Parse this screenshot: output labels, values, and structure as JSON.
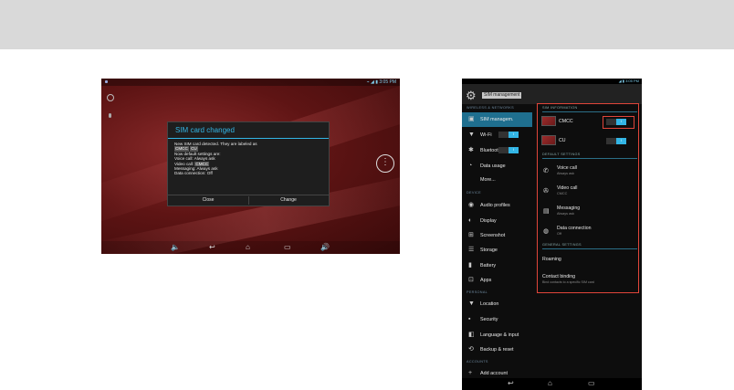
{
  "tablet": {
    "status_right": "⌁ ◢ ▮ 3:05 PM",
    "dialog": {
      "title": "SIM card changed",
      "line1": "New SIM card detected. They are labeled as",
      "chip1": "CMCC",
      "chip2": "CU",
      "line2": "Now default settings are:",
      "voice_label": "Voice call:",
      "voice_value": "Always ask",
      "video_label": "Video call:",
      "video_value": "CMCC",
      "msg_label": "Messaging:",
      "msg_value": "Always ask",
      "data_label": "Data connection:",
      "data_value": "Off",
      "close_button": "Close",
      "change_button": "Change"
    }
  },
  "phone": {
    "status_right": "◢ ▮ 3:05 PM",
    "title": "SIM management",
    "left": {
      "sec_wireless": "WIRELESS & NETWORKS",
      "items": [
        {
          "label": "SIM managem."
        },
        {
          "label": "Wi-Fi"
        },
        {
          "label": "Bluetooth"
        },
        {
          "label": "Data usage"
        },
        {
          "label": "More..."
        }
      ],
      "toggle_on": "I",
      "sec_device": "DEVICE",
      "device_items": [
        {
          "label": "Audio profiles"
        },
        {
          "label": "Display"
        },
        {
          "label": "Screenshot"
        },
        {
          "label": "Storage"
        },
        {
          "label": "Battery"
        },
        {
          "label": "Apps"
        }
      ],
      "sec_personal": "PERSONAL",
      "personal_items": [
        {
          "label": "Location"
        },
        {
          "label": "Security"
        },
        {
          "label": "Language & input"
        },
        {
          "label": "Backup & reset"
        }
      ],
      "sec_accounts": "ACCOUNTS",
      "accounts_items": [
        {
          "label": "Add account"
        }
      ]
    },
    "right": {
      "sec_info": "SIM INFORMATION",
      "sim1": "CMCC",
      "sim2": "CU",
      "toggle_on": "I",
      "sec_default": "DEFAULT SETTINGS",
      "voice_title": "Voice call",
      "voice_sub": "Always ask",
      "video_title": "Video call",
      "video_sub": "CMCC",
      "msg_title": "Messaging",
      "msg_sub": "Always ask",
      "data_title": "Data connection",
      "data_sub": "Off",
      "sec_general": "GENERAL SETTINGS",
      "roaming": "Roaming",
      "contact_binding": "Contact binding",
      "contact_binding_sub": "Bind contacts to a specific SIM card"
    }
  }
}
